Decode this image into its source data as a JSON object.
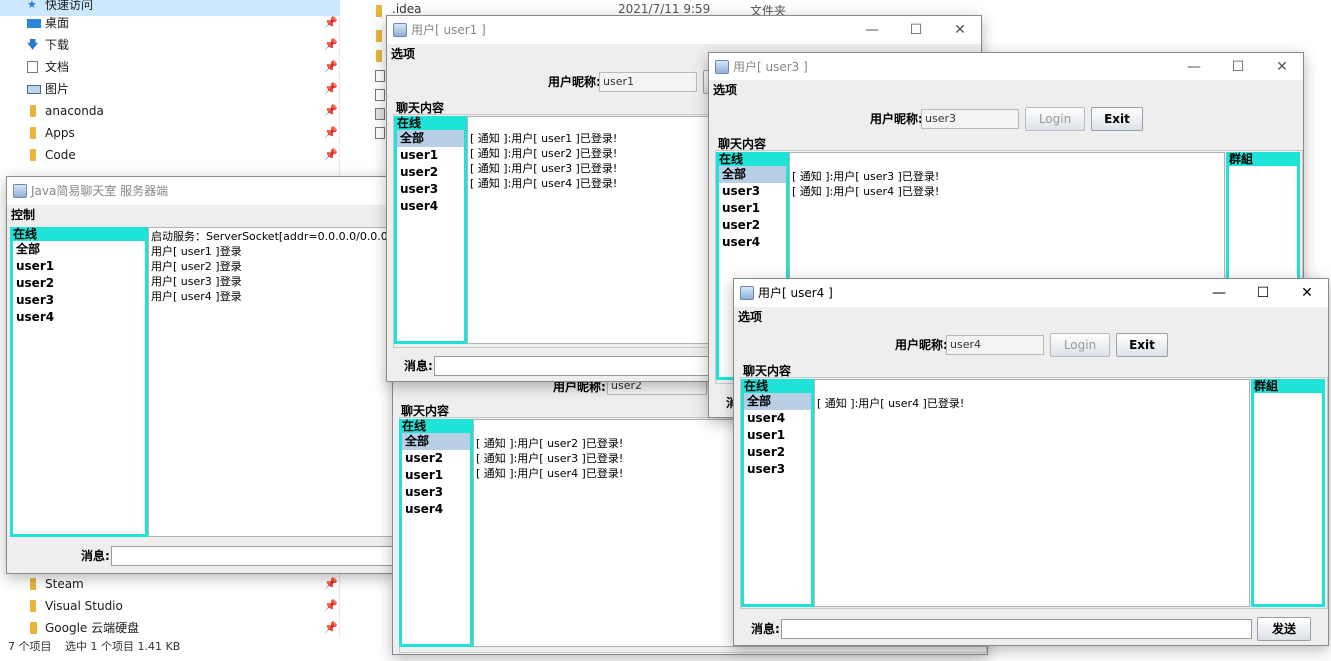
{
  "explorer": {
    "quick_access": "快速访问",
    "nav_items": [
      {
        "label": "桌面",
        "icon": "desktop-icon"
      },
      {
        "label": "下载",
        "icon": "download-icon"
      },
      {
        "label": "文档",
        "icon": "document-icon"
      },
      {
        "label": "图片",
        "icon": "picture-icon"
      },
      {
        "label": "anaconda",
        "icon": "folder-icon"
      },
      {
        "label": "Apps",
        "icon": "folder-icon"
      },
      {
        "label": "Code",
        "icon": "folder-icon"
      }
    ],
    "nav_items_bottom": [
      {
        "label": "Steam",
        "icon": "folder-icon"
      },
      {
        "label": "Visual Studio",
        "icon": "folder-icon"
      },
      {
        "label": "Google 云端硬盘",
        "icon": "google-drive-icon"
      }
    ],
    "status": {
      "items": "7 个项目",
      "selected": "选中 1 个项目  1.41 KB"
    },
    "file_row": {
      "name": ".idea",
      "date": "2021/7/11 9:59",
      "type": "文件夹"
    }
  },
  "server": {
    "title": "Java简易聊天室 服务器端",
    "menu": "控制",
    "online_header": "在线",
    "online_items": [
      "全部",
      "user1",
      "user2",
      "user3",
      "user4"
    ],
    "log": [
      "启动服务：ServerSocket[addr=0.0.0.0/0.0.0.0,loc",
      "用户[ user1 ]登录",
      "用户[ user2 ]登录",
      "用户[ user3 ]登录",
      "用户[ user4 ]登录"
    ],
    "message_label": "消息:"
  },
  "user1": {
    "title": "用户[ user1 ]",
    "menu": "选项",
    "nickname_label": "用户昵称:",
    "nickname": "user1",
    "chat_label": "聊天内容",
    "online_header": "在线",
    "online_items": [
      "全部",
      "user1",
      "user2",
      "user3",
      "user4"
    ],
    "messages": [
      "[ 通知 ]:用户[ user1 ]已登录!",
      "[ 通知 ]:用户[ user2 ]已登录!",
      "[ 通知 ]:用户[ user3 ]已登录!",
      "[ 通知 ]:用户[ user4 ]已登录!"
    ],
    "message_label": "消息:"
  },
  "user2": {
    "nickname_label": "用户昵称:",
    "nickname": "user2",
    "chat_label": "聊天内容",
    "online_header": "在线",
    "online_items": [
      "全部",
      "user2",
      "user1",
      "user3",
      "user4"
    ],
    "messages": [
      "[ 通知 ]:用户[ user2 ]已登录!",
      "[ 通知 ]:用户[ user3 ]已登录!",
      "[ 通知 ]:用户[ user4 ]已登录!"
    ]
  },
  "user3": {
    "title": "用户[ user3 ]",
    "menu": "选项",
    "nickname_label": "用户昵称:",
    "nickname": "user3",
    "login": "Login",
    "exit": "Exit",
    "chat_label": "聊天内容",
    "online_header": "在线",
    "online_items": [
      "全部",
      "user3",
      "user1",
      "user2",
      "user4"
    ],
    "group_header": "群組",
    "messages": [
      "[ 通知 ]:用户[ user3 ]已登录!",
      "[ 通知 ]:用户[ user4 ]已登录!"
    ],
    "message_label_partial": "消"
  },
  "user4": {
    "title": "用户[ user4 ]",
    "menu": "选项",
    "nickname_label": "用户昵称:",
    "nickname": "user4",
    "login": "Login",
    "exit": "Exit",
    "chat_label": "聊天内容",
    "online_header": "在线",
    "online_items": [
      "全部",
      "user4",
      "user1",
      "user2",
      "user3"
    ],
    "group_header": "群組",
    "messages": [
      "[ 通知 ]:用户[ user4 ]已登录!"
    ],
    "message_label": "消息:",
    "send": "发送"
  },
  "window_controls": {
    "minimize": "—",
    "maximize": "☐",
    "close": "✕"
  }
}
